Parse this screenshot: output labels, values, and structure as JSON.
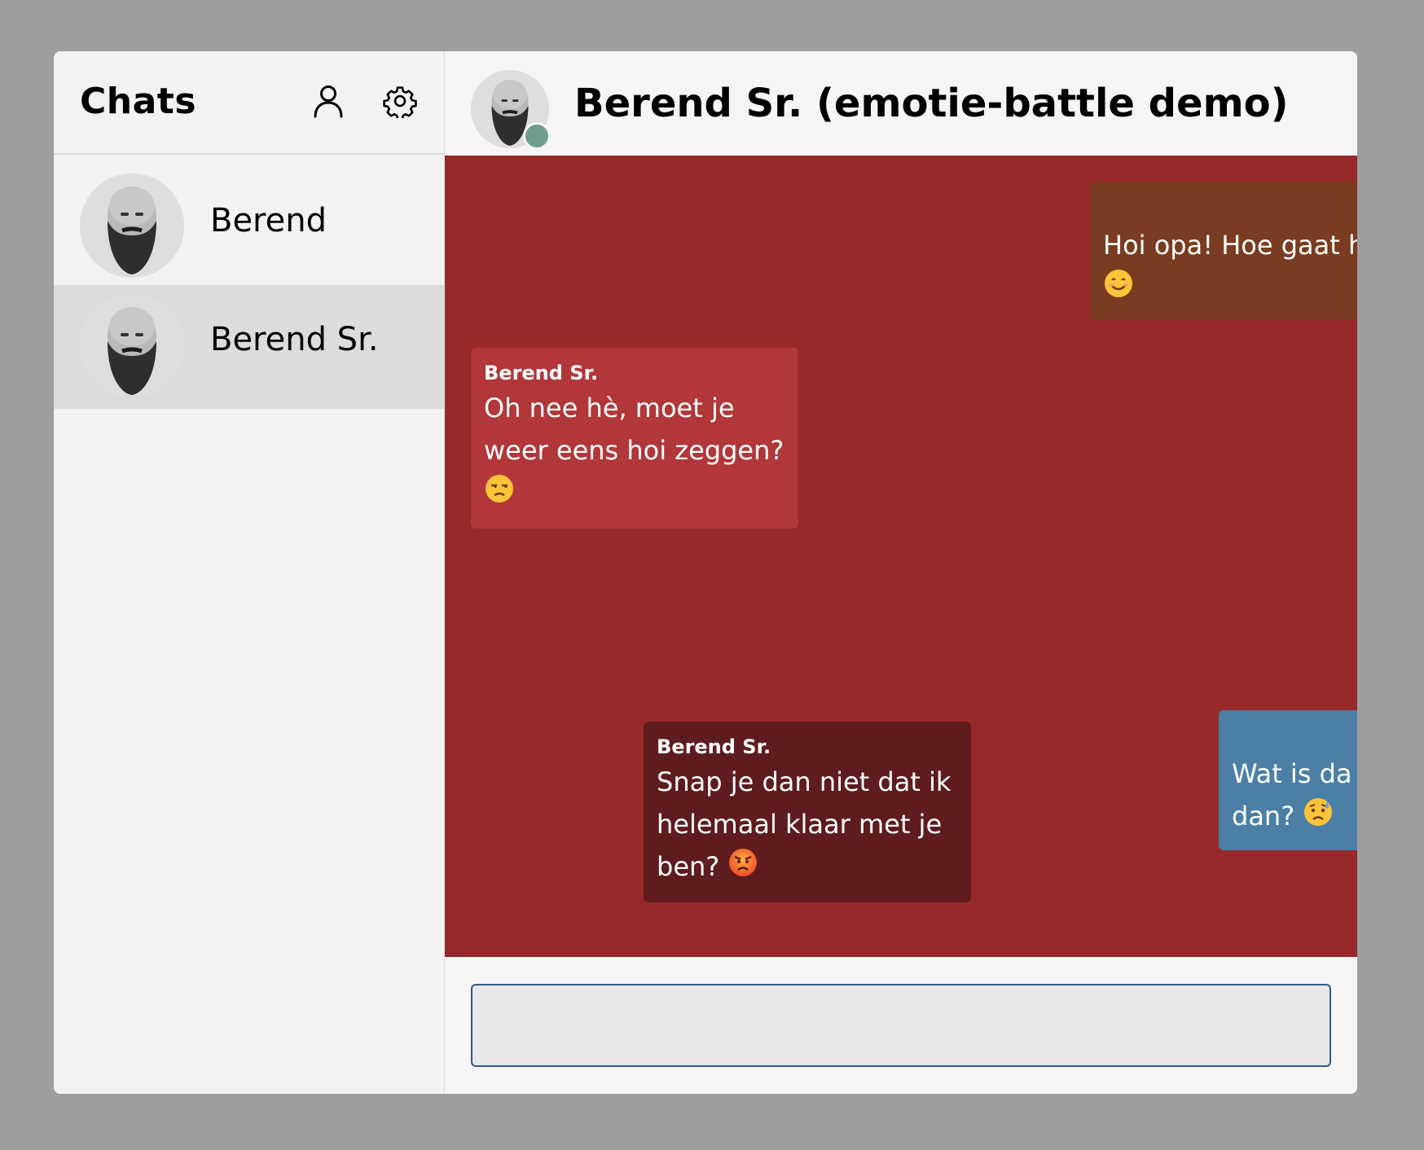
{
  "sidebar": {
    "title": "Chats",
    "icons": [
      "person-icon",
      "gear-icon"
    ],
    "chats": [
      {
        "name": "Berend",
        "selected": false
      },
      {
        "name": "Berend Sr.",
        "selected": true
      }
    ]
  },
  "chat": {
    "title": "Berend Sr. (emotie-battle demo)",
    "status": "online",
    "colors": {
      "background": "#97292b",
      "outgoing_1": "#7a3c20",
      "incoming_1": "#b1373a",
      "outgoing_2": "#4b7fa6",
      "incoming_2": "#5e1c1e",
      "online_dot": "#6f9e8e"
    },
    "messages": [
      {
        "direction": "outgoing",
        "sender": "",
        "text": "Hoi opa! Hoe gaat h",
        "emoji": "smiling-face"
      },
      {
        "direction": "incoming",
        "sender": "Berend Sr.",
        "text": "Oh nee hè, moet je weer eens hoi zeggen?",
        "emoji": "unamused-face"
      },
      {
        "direction": "outgoing",
        "sender": "",
        "text_line1": "Wat is da",
        "text_line2": "dan?",
        "emoji": "sad-sweat-face"
      },
      {
        "direction": "incoming",
        "sender": "Berend Sr.",
        "text": "Snap je dan niet dat ik helemaal klaar met je ben?",
        "emoji": "angry-face"
      }
    ]
  },
  "composer": {
    "value": "",
    "placeholder": ""
  }
}
